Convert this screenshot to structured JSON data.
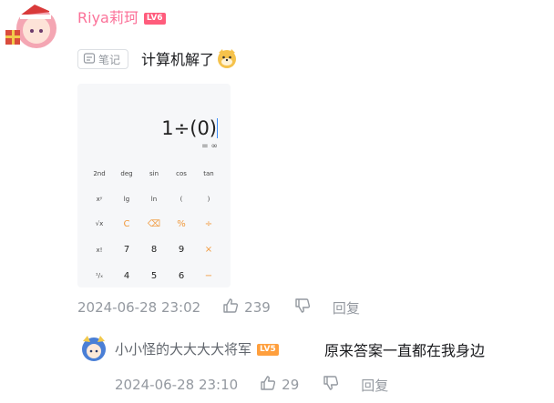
{
  "comment": {
    "username": "Riya莉珂",
    "level": "LV6",
    "tag_label": "笔记",
    "text": "计算机解了",
    "emote_icon": "doge-emote",
    "time": "2024-06-28 23:02",
    "likes": "239",
    "reply_label": "回复"
  },
  "calculator": {
    "expression": "1÷(0)",
    "result": "= ∞",
    "rows": [
      [
        "2nd",
        "deg",
        "sin",
        "cos",
        "tan"
      ],
      [
        "xʸ",
        "lg",
        "ln",
        "(",
        ")"
      ],
      [
        "√x",
        "C",
        "⌫",
        "%",
        "÷"
      ],
      [
        "x!",
        "7",
        "8",
        "9",
        "×"
      ],
      [
        "¹/ₓ",
        "4",
        "5",
        "6",
        "−"
      ]
    ]
  },
  "reply": {
    "username": "小小怪的大大大大将军",
    "level": "LV5",
    "text": "原来答案一直都在我身边",
    "time": "2024-06-28 23:10",
    "likes": "29",
    "reply_label": "回复"
  },
  "colors": {
    "username_vip": "#fb7299",
    "lv6": "#ff5c7c",
    "lv5": "#ff9f3d",
    "meta_gray": "#9499a0",
    "calc_accent": "#f19a3e"
  }
}
